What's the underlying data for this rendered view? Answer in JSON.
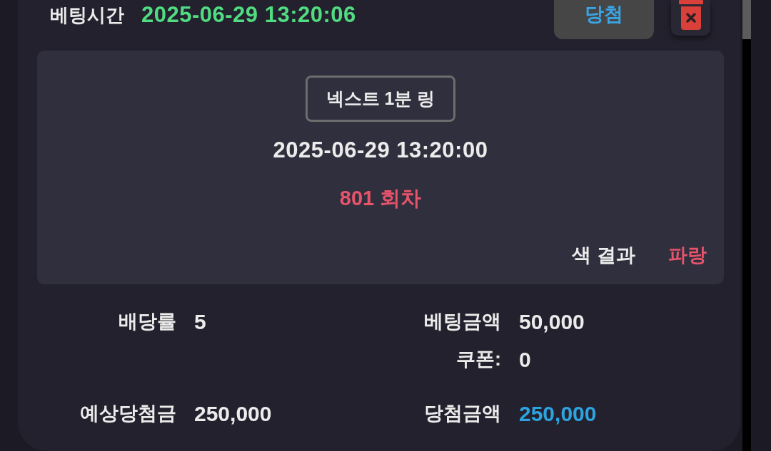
{
  "bet_time": {
    "label": "베팅시간",
    "value": "2025-06-29 13:20:06"
  },
  "result_button": {
    "label": "당첨"
  },
  "game": {
    "name": "넥스트 1분 링",
    "draw_time": "2025-06-29 13:20:00",
    "round": "801 회차",
    "result_label": "색 결과",
    "result_value": "파랑"
  },
  "details": [
    {
      "left": [
        {
          "label": "배당률",
          "value": "5",
          "highlight": false
        }
      ],
      "right": [
        {
          "label": "베팅금액",
          "value": "50,000",
          "highlight": false
        },
        {
          "label": "쿠폰:",
          "value": "0",
          "highlight": false
        }
      ]
    },
    {
      "left": [
        {
          "label": "예상당첨금",
          "value": "250,000",
          "highlight": false
        }
      ],
      "right": [
        {
          "label": "당첨금액",
          "value": "250,000",
          "highlight": true
        }
      ]
    }
  ]
}
